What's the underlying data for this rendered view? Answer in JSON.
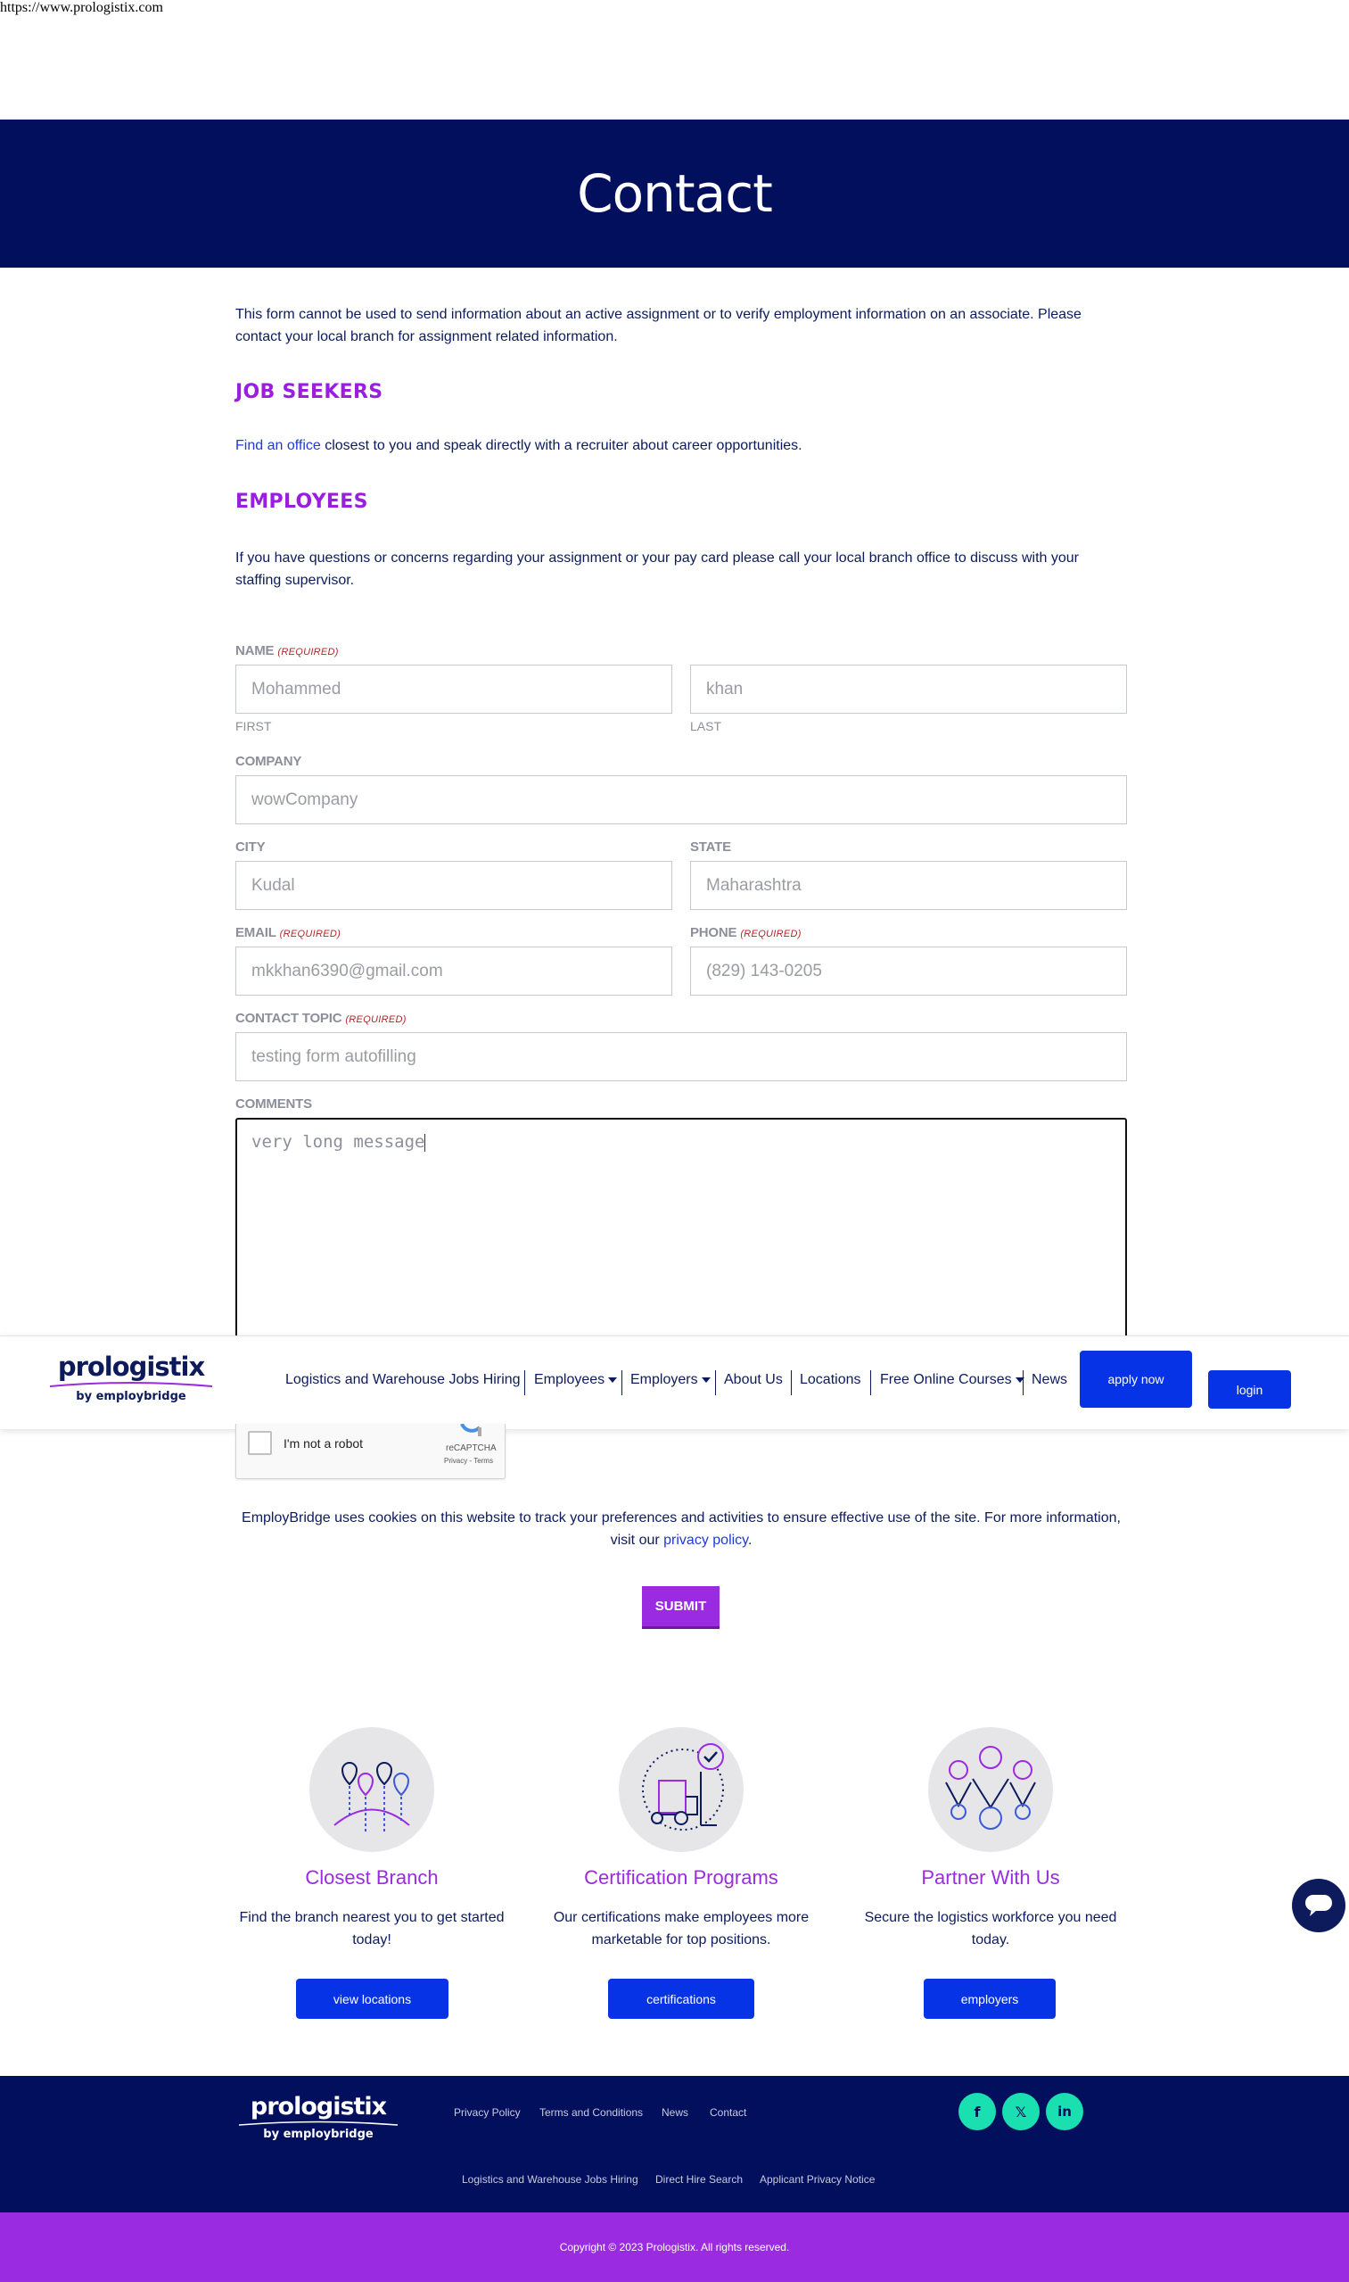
{
  "browser": {
    "url": "https://www.prologistix.com"
  },
  "hero": {
    "title": "Contact"
  },
  "intro": {
    "text": "This form cannot be used to send information about an active assignment or to verify employment information on an associate. Please contact your local branch for assignment related information."
  },
  "job_seekers": {
    "heading": "JOB SEEKERS",
    "link_text": "Find an office",
    "text": " closest to you and speak directly with a recruiter about career opportunities."
  },
  "employees": {
    "heading": "EMPLOYEES",
    "text": "If you have questions or concerns regarding your assignment or your pay card please call your local branch office to discuss with your staffing supervisor."
  },
  "form": {
    "required_tag": "(REQUIRED)",
    "name": {
      "label": "NAME",
      "first_value": "Mohammed",
      "first_sublabel": "FIRST",
      "last_value": "khan",
      "last_sublabel": "LAST"
    },
    "company": {
      "label": "COMPANY",
      "value": "wowCompany"
    },
    "city": {
      "label": "CITY",
      "value": "Kudal"
    },
    "state": {
      "label": "STATE",
      "value": "Maharashtra"
    },
    "email": {
      "label": "EMAIL",
      "value": "mkkhan6390@gmail.com"
    },
    "phone": {
      "label": "PHONE",
      "value": "(829) 143-0205"
    },
    "contact_topic": {
      "label": "CONTACT TOPIC",
      "value": "testing form autofilling"
    },
    "comments": {
      "label": "COMMENTS",
      "value": "very long message"
    },
    "captcha": {
      "label": "I'm not a robot",
      "brand": "reCAPTCHA",
      "links": "Privacy - Terms"
    },
    "submit_label": "SUBMIT"
  },
  "cookie_notice": {
    "text": "EmployBridge uses cookies on this website to track your preferences and activities to ensure effective use of the site. For more information, visit our ",
    "link_text": "privacy policy",
    "suffix": "."
  },
  "navbar": {
    "logo_main": "prologistix",
    "logo_sub": "by employbridge",
    "items": [
      {
        "label": "Logistics and Warehouse Jobs Hiring"
      },
      {
        "label": "Employees"
      },
      {
        "label": "Employers"
      },
      {
        "label": "About Us"
      },
      {
        "label": "Locations"
      },
      {
        "label": "Free Online Courses"
      },
      {
        "label": "News"
      }
    ],
    "apply_label": "apply now",
    "login_label": "login"
  },
  "cards": [
    {
      "title": "Closest Branch",
      "description": "Find the branch nearest you to get started today!",
      "button": "view locations",
      "icon": "map-pins-icon"
    },
    {
      "title": "Certification Programs",
      "description": "Our certifications make employees more marketable for top positions.",
      "button": "certifications",
      "icon": "forklift-check-icon"
    },
    {
      "title": "Partner With Us",
      "description": "Secure the logistics workforce you need today.",
      "button": "employers",
      "icon": "people-medals-icon"
    }
  ],
  "footer": {
    "logo_main": "prologistix",
    "logo_sub": "by employbridge",
    "top_links": [
      "Privacy Policy",
      "Terms and Conditions",
      "News",
      "Contact"
    ],
    "bottom_links": [
      "Logistics and Warehouse Jobs Hiring",
      "Direct Hire Search",
      "Applicant Privacy Notice"
    ],
    "social": [
      "facebook-icon",
      "x-icon",
      "linkedin-icon"
    ],
    "copyright": "Copyright © 2023 Prologistix. All rights reserved."
  },
  "colors": {
    "navy": "#020f5c",
    "purple": "#9a2be0",
    "blue": "#0633e6",
    "teal": "#19dfb1"
  }
}
